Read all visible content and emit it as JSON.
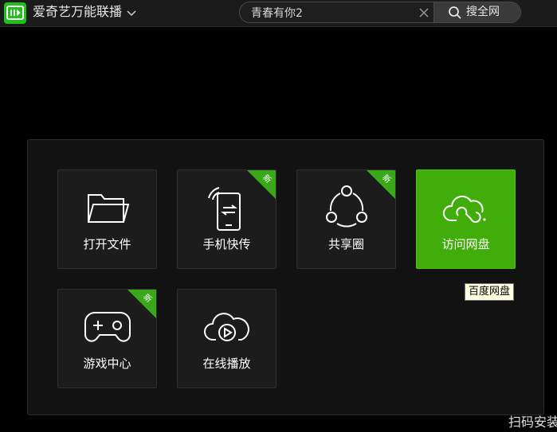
{
  "app": {
    "title": "爱奇艺万能联播",
    "brand_color": "#1fc01a"
  },
  "search": {
    "value": "青春有你2",
    "button_label": "搜全网"
  },
  "tiles": [
    {
      "label": "打开文件",
      "icon": "folder-icon",
      "new": false,
      "active": false
    },
    {
      "label": "手机快传",
      "icon": "phone-transfer-icon",
      "new": true,
      "active": false
    },
    {
      "label": "共享圈",
      "icon": "share-circle-icon",
      "new": true,
      "active": false
    },
    {
      "label": "访问网盘",
      "icon": "cloud-drive-icon",
      "new": false,
      "active": true
    },
    {
      "label": "游戏中心",
      "icon": "gamepad-icon",
      "new": true,
      "active": false
    },
    {
      "label": "在线播放",
      "icon": "cloud-play-icon",
      "new": false,
      "active": false
    }
  ],
  "badge_label": "新",
  "badge_color": "#3aa81a",
  "active_color": "#40ad0a",
  "tooltip": "百度网盘",
  "footer": {
    "scan_text": "扫码安装"
  }
}
